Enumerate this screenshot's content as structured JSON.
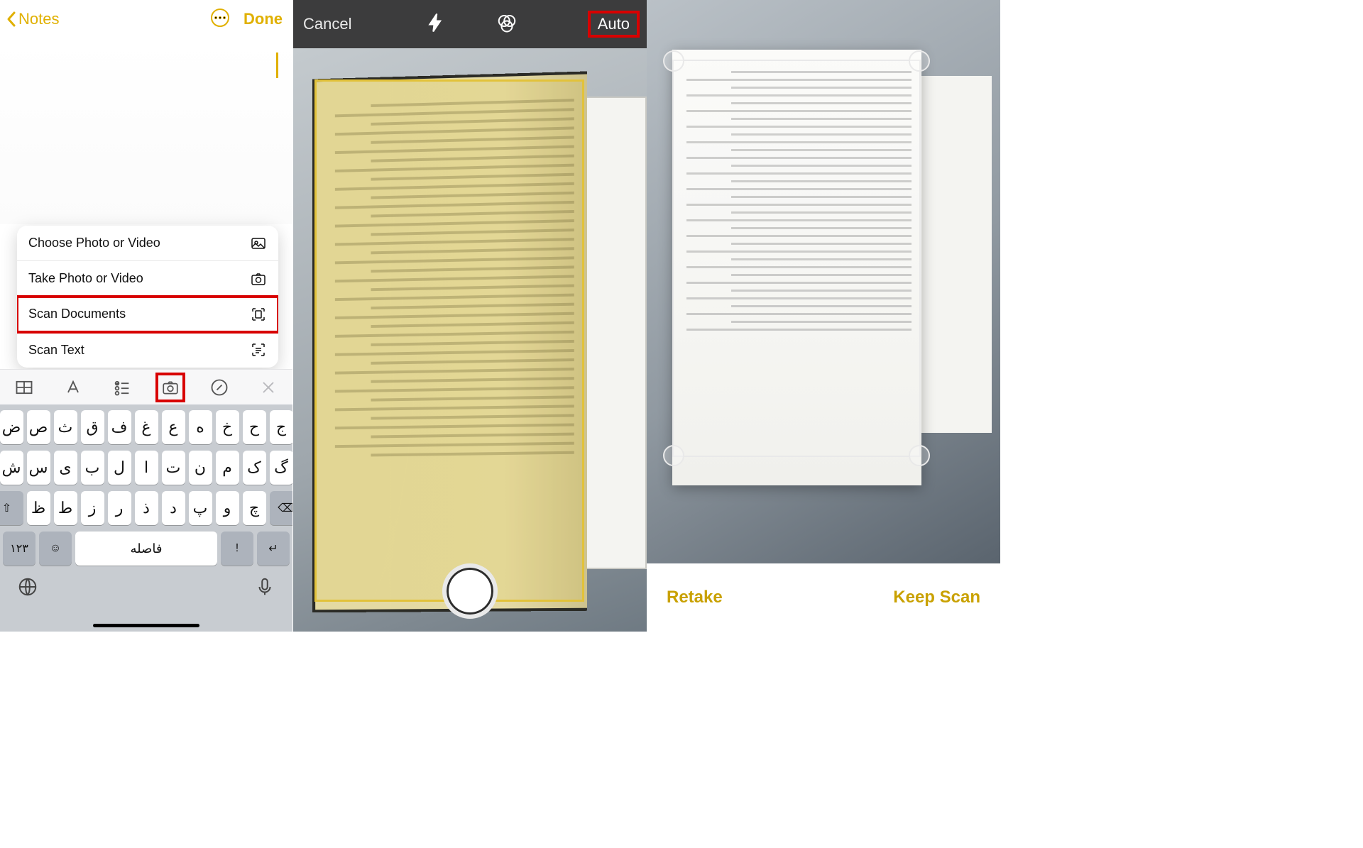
{
  "screen1": {
    "back_label": "Notes",
    "done_label": "Done",
    "menu": {
      "choose": "Choose Photo or Video",
      "take": "Take Photo or Video",
      "scan_docs": "Scan Documents",
      "scan_text": "Scan Text"
    },
    "keyboard": {
      "row1": [
        "ض",
        "ص",
        "ث",
        "ق",
        "ف",
        "غ",
        "ع",
        "ه",
        "خ",
        "ح",
        "ج"
      ],
      "row2": [
        "ش",
        "س",
        "ی",
        "ب",
        "ل",
        "ا",
        "ت",
        "ن",
        "م",
        "ک",
        "گ"
      ],
      "row3": [
        "ظ",
        "ط",
        "ز",
        "ر",
        "ذ",
        "د",
        "پ",
        "و",
        "چ"
      ],
      "space": "فاصله",
      "num_key": "۱۲۳",
      "return_key": "↵"
    }
  },
  "screen2": {
    "cancel": "Cancel",
    "auto": "Auto"
  },
  "screen3": {
    "retake": "Retake",
    "keep": "Keep Scan"
  }
}
